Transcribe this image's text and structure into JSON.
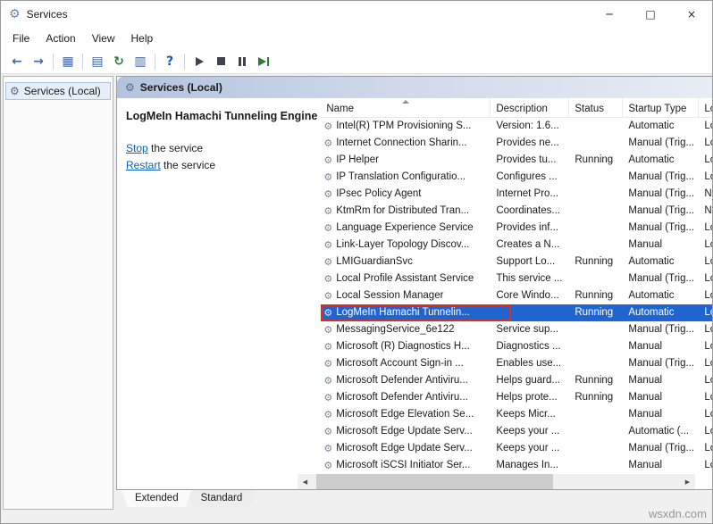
{
  "window": {
    "title": "Services",
    "caption_buttons": {
      "minimize": "─",
      "maximize": "□",
      "close": "×"
    }
  },
  "menu": {
    "items": [
      "File",
      "Action",
      "View",
      "Help"
    ]
  },
  "toolbar": {
    "buttons": [
      {
        "name": "back",
        "glyph": "←",
        "color": "#44659c"
      },
      {
        "name": "forward",
        "glyph": "→",
        "color": "#44659c"
      },
      {
        "sep": true
      },
      {
        "name": "show-hide-console-tree",
        "glyph": "▦",
        "color": "#44659c"
      },
      {
        "sep": true
      },
      {
        "name": "properties",
        "glyph": "▤",
        "color": "#44659c"
      },
      {
        "name": "refresh",
        "glyph": "↻",
        "color": "#2e7d32"
      },
      {
        "name": "export-list",
        "glyph": "▥",
        "color": "#44659c"
      },
      {
        "sep": true
      },
      {
        "name": "help",
        "glyph": "?",
        "color": "#1a5dab"
      },
      {
        "sep": true
      },
      {
        "name": "start-service",
        "shape": "play"
      },
      {
        "name": "stop-service",
        "shape": "stop"
      },
      {
        "name": "pause-service",
        "shape": "pause"
      },
      {
        "name": "restart-service",
        "shape": "restart"
      }
    ]
  },
  "tree": {
    "root": "Services (Local)"
  },
  "main": {
    "header": "Services (Local)",
    "detail": {
      "title": "LogMeIn Hamachi Tunneling Engine",
      "links": [
        {
          "link": "Stop",
          "suffix": " the service"
        },
        {
          "link": "Restart",
          "suffix": " the service"
        }
      ]
    },
    "table": {
      "columns": [
        "Name",
        "Description",
        "Status",
        "Startup Type",
        "Log..."
      ],
      "rows": [
        {
          "name": "Intel(R) TPM Provisioning S...",
          "desc": "Version: 1.6...",
          "status": "",
          "startup": "Automatic",
          "logon": "Loc..."
        },
        {
          "name": "Internet Connection Sharin...",
          "desc": "Provides ne...",
          "status": "",
          "startup": "Manual (Trig...",
          "logon": "Loc..."
        },
        {
          "name": "IP Helper",
          "desc": "Provides tu...",
          "status": "Running",
          "startup": "Automatic",
          "logon": "Loc..."
        },
        {
          "name": "IP Translation Configuratio...",
          "desc": "Configures ...",
          "status": "",
          "startup": "Manual (Trig...",
          "logon": "Loc..."
        },
        {
          "name": "IPsec Policy Agent",
          "desc": "Internet Pro...",
          "status": "",
          "startup": "Manual (Trig...",
          "logon": "Net..."
        },
        {
          "name": "KtmRm for Distributed Tran...",
          "desc": "Coordinates...",
          "status": "",
          "startup": "Manual (Trig...",
          "logon": "Net..."
        },
        {
          "name": "Language Experience Service",
          "desc": "Provides inf...",
          "status": "",
          "startup": "Manual (Trig...",
          "logon": "Loc..."
        },
        {
          "name": "Link-Layer Topology Discov...",
          "desc": "Creates a N...",
          "status": "",
          "startup": "Manual",
          "logon": "Loc..."
        },
        {
          "name": "LMIGuardianSvc",
          "desc": "Support Lo...",
          "status": "Running",
          "startup": "Automatic",
          "logon": "Loc..."
        },
        {
          "name": "Local Profile Assistant Service",
          "desc": "This service ...",
          "status": "",
          "startup": "Manual (Trig...",
          "logon": "Loc..."
        },
        {
          "name": "Local Session Manager",
          "desc": "Core Windo...",
          "status": "Running",
          "startup": "Automatic",
          "logon": "Loc..."
        },
        {
          "name": "LogMeIn Hamachi Tunnelin...",
          "desc": "",
          "status": "Running",
          "startup": "Automatic",
          "logon": "Loc...",
          "selected": true
        },
        {
          "name": "MessagingService_6e122",
          "desc": "Service sup...",
          "status": "",
          "startup": "Manual (Trig...",
          "logon": "Loc..."
        },
        {
          "name": "Microsoft (R) Diagnostics H...",
          "desc": "Diagnostics ...",
          "status": "",
          "startup": "Manual",
          "logon": "Loc..."
        },
        {
          "name": "Microsoft Account Sign-in ...",
          "desc": "Enables use...",
          "status": "",
          "startup": "Manual (Trig...",
          "logon": "Loc..."
        },
        {
          "name": "Microsoft Defender Antiviru...",
          "desc": "Helps guard...",
          "status": "Running",
          "startup": "Manual",
          "logon": "Loc..."
        },
        {
          "name": "Microsoft Defender Antiviru...",
          "desc": "Helps prote...",
          "status": "Running",
          "startup": "Manual",
          "logon": "Loc..."
        },
        {
          "name": "Microsoft Edge Elevation Se...",
          "desc": "Keeps Micr...",
          "status": "",
          "startup": "Manual",
          "logon": "Loc..."
        },
        {
          "name": "Microsoft Edge Update Serv...",
          "desc": "Keeps your ...",
          "status": "",
          "startup": "Automatic (...",
          "logon": "Loc..."
        },
        {
          "name": "Microsoft Edge Update Serv...",
          "desc": "Keeps your ...",
          "status": "",
          "startup": "Manual (Trig...",
          "logon": "Loc..."
        },
        {
          "name": "Microsoft iSCSI Initiator Ser...",
          "desc": "Manages In...",
          "status": "",
          "startup": "Manual",
          "logon": "Loc..."
        }
      ]
    },
    "tabs": [
      "Extended",
      "Standard"
    ]
  },
  "watermark": "wsxdn.com",
  "colors": {
    "selection": "#2065cf",
    "annotation": "#d93025",
    "link": "#0563c1"
  }
}
